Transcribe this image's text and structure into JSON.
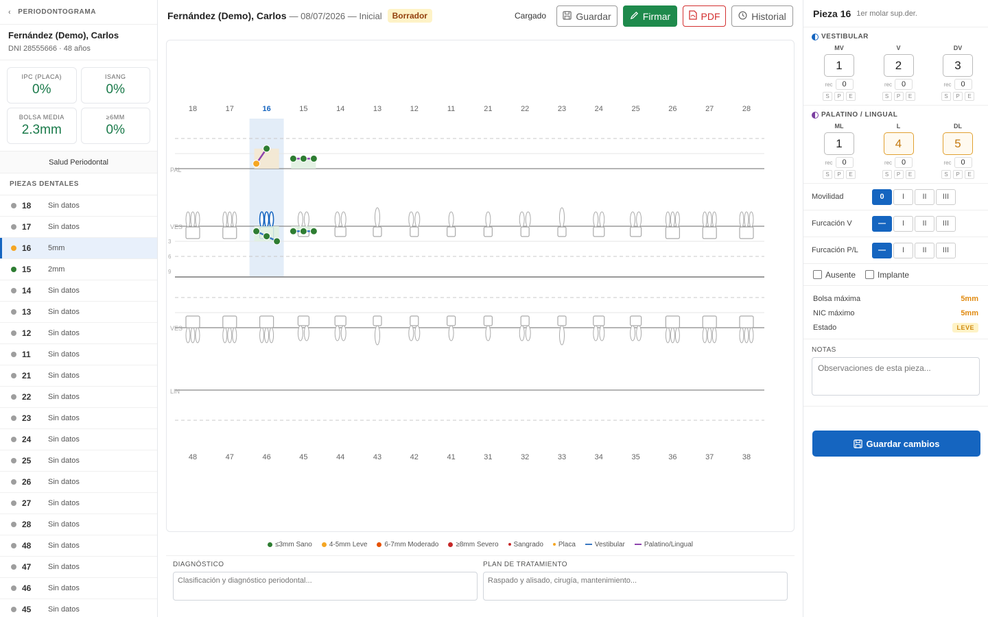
{
  "sidebar": {
    "section_title": "PERIODONTOGRAMA",
    "patient_name": "Fernández (Demo), Carlos",
    "patient_info": "DNI 28555666 · 48 años",
    "stats": [
      {
        "label": "IPC (PLACA)",
        "value": "0%"
      },
      {
        "label": "ISANG",
        "value": "0%"
      },
      {
        "label": "BOLSA MEDIA",
        "value": "2.3mm"
      },
      {
        "label": "≥6MM",
        "value": "0%"
      }
    ],
    "health_label": "Salud Periodontal",
    "teeth_title": "PIEZAS DENTALES",
    "teeth": [
      {
        "num": "18",
        "value": "Sin datos",
        "color": "#9e9e9e"
      },
      {
        "num": "17",
        "value": "Sin datos",
        "color": "#9e9e9e"
      },
      {
        "num": "16",
        "value": "5mm",
        "color": "#f5a623"
      },
      {
        "num": "15",
        "value": "2mm",
        "color": "#2e7d32"
      },
      {
        "num": "14",
        "value": "Sin datos",
        "color": "#9e9e9e"
      },
      {
        "num": "13",
        "value": "Sin datos",
        "color": "#9e9e9e"
      },
      {
        "num": "12",
        "value": "Sin datos",
        "color": "#9e9e9e"
      },
      {
        "num": "11",
        "value": "Sin datos",
        "color": "#9e9e9e"
      },
      {
        "num": "21",
        "value": "Sin datos",
        "color": "#9e9e9e"
      },
      {
        "num": "22",
        "value": "Sin datos",
        "color": "#9e9e9e"
      },
      {
        "num": "23",
        "value": "Sin datos",
        "color": "#9e9e9e"
      },
      {
        "num": "24",
        "value": "Sin datos",
        "color": "#9e9e9e"
      },
      {
        "num": "25",
        "value": "Sin datos",
        "color": "#9e9e9e"
      },
      {
        "num": "26",
        "value": "Sin datos",
        "color": "#9e9e9e"
      },
      {
        "num": "27",
        "value": "Sin datos",
        "color": "#9e9e9e"
      },
      {
        "num": "28",
        "value": "Sin datos",
        "color": "#9e9e9e"
      },
      {
        "num": "48",
        "value": "Sin datos",
        "color": "#9e9e9e"
      },
      {
        "num": "47",
        "value": "Sin datos",
        "color": "#9e9e9e"
      },
      {
        "num": "46",
        "value": "Sin datos",
        "color": "#9e9e9e"
      },
      {
        "num": "45",
        "value": "Sin datos",
        "color": "#9e9e9e"
      }
    ],
    "selected_tooth": "16"
  },
  "topbar": {
    "patient_name": "Fernández (Demo), Carlos",
    "meta": "— 08/07/2026 — Inicial",
    "status_badge": "Borrador",
    "load_status": "Cargado",
    "save_label": "Guardar",
    "sign_label": "Firmar",
    "pdf_label": "PDF",
    "history_label": "Historial"
  },
  "chart": {
    "upper_teeth": [
      "18",
      "17",
      "16",
      "15",
      "14",
      "13",
      "12",
      "11",
      "21",
      "22",
      "23",
      "24",
      "25",
      "26",
      "27",
      "28"
    ],
    "lower_teeth": [
      "48",
      "47",
      "46",
      "45",
      "44",
      "43",
      "42",
      "41",
      "31",
      "32",
      "33",
      "34",
      "35",
      "36",
      "37",
      "38"
    ],
    "row_labels": {
      "pal": "PAL",
      "ves_upper": "VES",
      "ves_lower": "VES",
      "lin": "LIN"
    },
    "depth_ticks": [
      "3",
      "6",
      "9"
    ],
    "highlight_tooth": "16",
    "palatal_points": [
      {
        "tooth": "16",
        "site": "ML",
        "depth": 1,
        "color": "#f5a623"
      },
      {
        "tooth": "16",
        "site": "L",
        "depth": 4,
        "color": "#2e7d32"
      },
      {
        "tooth": "15",
        "site": "ML",
        "depth": 2,
        "color": "#2e7d32"
      },
      {
        "tooth": "15",
        "site": "L",
        "depth": 2,
        "color": "#2e7d32"
      },
      {
        "tooth": "15",
        "site": "DL",
        "depth": 2,
        "color": "#2e7d32"
      }
    ],
    "vestibular_points": [
      {
        "tooth": "16",
        "site": "MV",
        "depth": 1,
        "color": "#2e7d32"
      },
      {
        "tooth": "16",
        "site": "V",
        "depth": 2,
        "color": "#2e7d32"
      },
      {
        "tooth": "16",
        "site": "DV",
        "depth": 3,
        "color": "#2e7d32"
      },
      {
        "tooth": "15",
        "site": "MV",
        "depth": 1,
        "color": "#2e7d32"
      },
      {
        "tooth": "15",
        "site": "V",
        "depth": 1,
        "color": "#2e7d32"
      },
      {
        "tooth": "15",
        "site": "DV",
        "depth": 1,
        "color": "#2e7d32"
      }
    ],
    "line_colors": {
      "vestibular": "#3a78c2",
      "palatal": "#8e44ad"
    }
  },
  "legend": [
    {
      "label": "≤3mm Sano",
      "color": "#2e7d32",
      "kind": "dot"
    },
    {
      "label": "4-5mm Leve",
      "color": "#f5a623",
      "kind": "dot"
    },
    {
      "label": "6-7mm Moderado",
      "color": "#e65100",
      "kind": "dot"
    },
    {
      "label": "≥8mm Severo",
      "color": "#c62828",
      "kind": "dot"
    },
    {
      "label": "Sangrado",
      "color": "#c62828",
      "kind": "small"
    },
    {
      "label": "Placa",
      "color": "#f5a623",
      "kind": "small"
    },
    {
      "label": "Vestibular",
      "color": "#3a78c2",
      "kind": "line"
    },
    {
      "label": "Palatino/Lingual",
      "color": "#8e44ad",
      "kind": "line"
    }
  ],
  "diagnosis": {
    "label": "DIAGNÓSTICO",
    "placeholder": "Clasificación y diagnóstico periodontal..."
  },
  "treatment": {
    "label": "PLAN DE TRATAMIENTO",
    "placeholder": "Raspado y alisado, cirugía, mantenimiento..."
  },
  "panel": {
    "title": "Pieza 16",
    "subtitle": "1er molar sup.der.",
    "vestibular_title": "VESTIBULAR",
    "vestibular_sites": [
      {
        "name": "MV",
        "depth": "1",
        "rec": "0"
      },
      {
        "name": "V",
        "depth": "2",
        "rec": "0"
      },
      {
        "name": "DV",
        "depth": "3",
        "rec": "0"
      }
    ],
    "palatal_title": "PALATINO / LINGUAL",
    "palatal_sites": [
      {
        "name": "ML",
        "depth": "1",
        "rec": "0"
      },
      {
        "name": "L",
        "depth": "4",
        "rec": "0"
      },
      {
        "name": "DL",
        "depth": "5",
        "rec": "0"
      }
    ],
    "rec_label": "rec",
    "spe": [
      "S",
      "P",
      "E"
    ],
    "mobility_label": "Movilidad",
    "mobility_options": [
      "0",
      "I",
      "II",
      "III"
    ],
    "mobility_selected": "0",
    "furcation_v_label": "Furcación V",
    "furcation_pl_label": "Furcación P/L",
    "furcation_options": [
      "—",
      "I",
      "II",
      "III"
    ],
    "furcation_selected": "—",
    "absent_label": "Ausente",
    "implant_label": "Implante",
    "max_pocket_label": "Bolsa máxima",
    "max_pocket": "5mm",
    "max_nic_label": "NIC máximo",
    "max_nic": "5mm",
    "state_label": "Estado",
    "state": "LEVE",
    "notes_label": "NOTAS",
    "notes_placeholder": "Observaciones de esta pieza...",
    "save_changes": "Guardar cambios"
  }
}
